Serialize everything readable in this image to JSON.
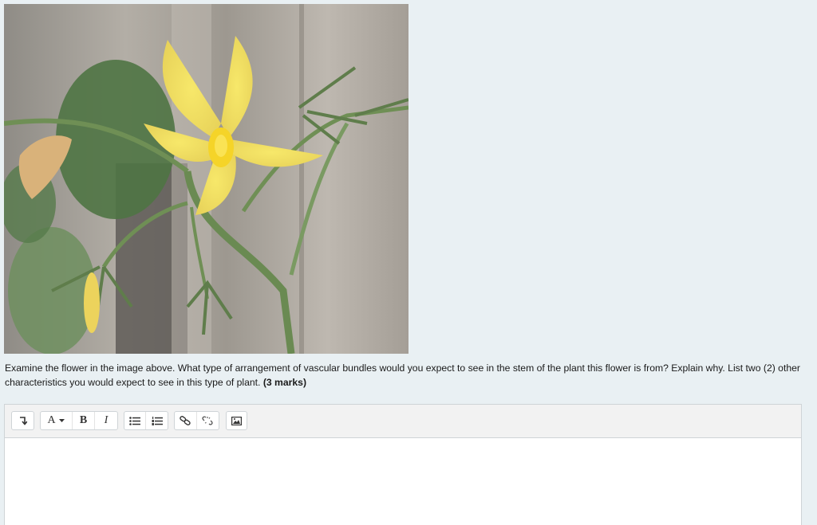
{
  "question": {
    "text": "Examine the flower in the image above.  What type of arrangement of vascular bundles would you expect to see in the stem of the plant this flower is from?  Explain why.  List two (2) other characteristics you would expect to see in this type of plant. ",
    "marks": "(3 marks)"
  },
  "toolbar": {
    "font_label": "A",
    "bold_label": "B",
    "italic_label": "I"
  },
  "icons": {
    "collapse": "collapse-icon",
    "font_color": "font-color-icon",
    "unordered_list": "unordered-list-icon",
    "ordered_list": "ordered-list-icon",
    "link": "link-icon",
    "unlink": "unlink-icon",
    "image": "image-icon"
  },
  "colors": {
    "background": "#e9f0f3",
    "petal": "#f2e06b",
    "wood": "#a9a49c",
    "leaf": "#5e7d4c"
  }
}
